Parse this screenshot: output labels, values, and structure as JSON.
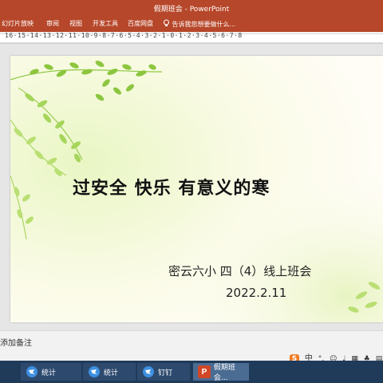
{
  "window": {
    "title": "假期班会 - PowerPoint"
  },
  "ribbon": {
    "tabs": [
      "幻灯片放映",
      "审阅",
      "视图",
      "开发工具",
      "百度网盘"
    ],
    "tell_me": "告诉我您想要做什么..."
  },
  "ruler": {
    "labels": "16·15·14·13·12·11·10·9·8·7·6·5·4·3·2·1·0·1·2·3·4·5·6·7·8"
  },
  "slide": {
    "title": "过安全 快乐 有意义的寒",
    "subtitle": "密云六小 四（4）线上班会",
    "date": "2022.2.11"
  },
  "notes": {
    "placeholder": "添加备注"
  },
  "ime": {
    "label": "中"
  },
  "taskbar": {
    "items": [
      {
        "label": "统计"
      },
      {
        "label": "统计"
      },
      {
        "label": "钉钉"
      },
      {
        "label": "假期班会..."
      }
    ]
  },
  "colors": {
    "accent": "#b7472a",
    "taskbar": "#203a5a",
    "leaf": "#8cc63f"
  }
}
